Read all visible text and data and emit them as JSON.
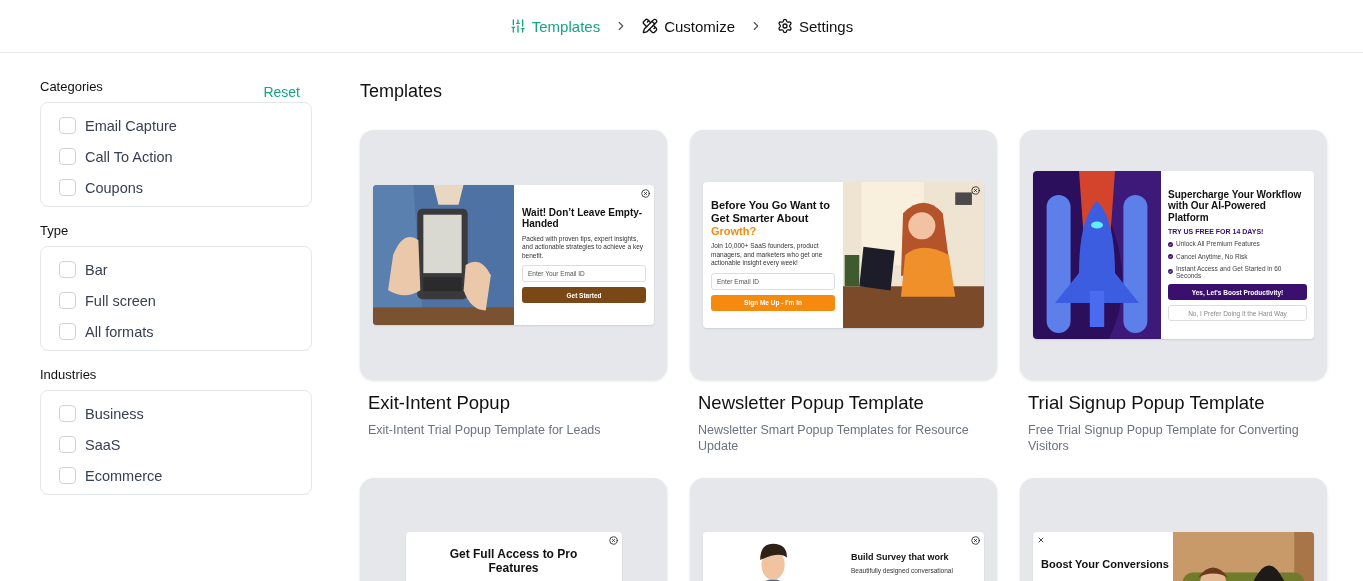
{
  "steps": [
    {
      "label": "Templates",
      "selected": true
    },
    {
      "label": "Customize",
      "selected": false
    },
    {
      "label": "Settings",
      "selected": false
    }
  ],
  "filters": {
    "reset": "Reset",
    "groups": [
      {
        "title": "Categories",
        "options": [
          {
            "label": "Email Capture",
            "checked": false
          },
          {
            "label": "Call To Action",
            "checked": false
          },
          {
            "label": "Coupons",
            "checked": false
          }
        ]
      },
      {
        "title": "Type",
        "options": [
          {
            "label": "Bar",
            "checked": false
          },
          {
            "label": "Full screen",
            "checked": false
          },
          {
            "label": "All formats",
            "checked": false
          }
        ]
      },
      {
        "title": "Industries",
        "options": [
          {
            "label": "Business",
            "checked": false
          },
          {
            "label": "SaaS",
            "checked": false
          },
          {
            "label": "Ecommerce",
            "checked": false
          }
        ]
      }
    ]
  },
  "main": {
    "title": "Templates",
    "templates": [
      {
        "name": "Exit-Intent Popup",
        "description": "Exit-Intent Trial Popup Template for Leads",
        "preview": {
          "kind": "reader",
          "title": "Wait! Don’t Leave Empty-Handed",
          "body": "Packed with proven tips, expert insights, and actionable strategies to achieve a key benefit.",
          "input": "Enter Your Email ID",
          "button": "Get Started",
          "color": "#7a4816"
        }
      },
      {
        "name": "Newsletter Popup Template",
        "description": "Newsletter Smart Popup Templates for Resource Update",
        "preview": {
          "kind": "desk",
          "title": "Before You Go Want to Get Smarter About",
          "highlight": "Growth?",
          "body": "Join 10,000+ SaaS founders, product managers, and marketers who get one actionable insight every week!",
          "input": "Enter Email ID",
          "button": "Sign Me Up - I'm In",
          "color": "#f68a0e"
        }
      },
      {
        "name": "Trial Signup Popup Template",
        "description": "Free Trial Signup Popup Template for Converting Visitors",
        "preview": {
          "kind": "rocket",
          "title": "Supercharge Your Workflow with Our AI-Powered Platform",
          "subtitle": "TRY US FREE FOR 14 DAYS!",
          "features": [
            "Unlock All Premium Features",
            "Cancel Anytime, No Risk",
            "Instant Access and Get Started in 60 Seconds"
          ],
          "button": "Yes, Let's Boost Productivity!",
          "secondary": "No, I Prefer Doing It the Hard Way",
          "color": "#3b0f6e"
        }
      },
      {
        "preview": {
          "kind": "pro",
          "title": "Get Full Access to Pro Features"
        }
      },
      {
        "preview": {
          "kind": "survey",
          "title": "Build Survey that work",
          "body": "Beautifully designed conversational"
        }
      },
      {
        "preview": {
          "kind": "people",
          "title": "Boost Your Conversions"
        }
      }
    ]
  }
}
